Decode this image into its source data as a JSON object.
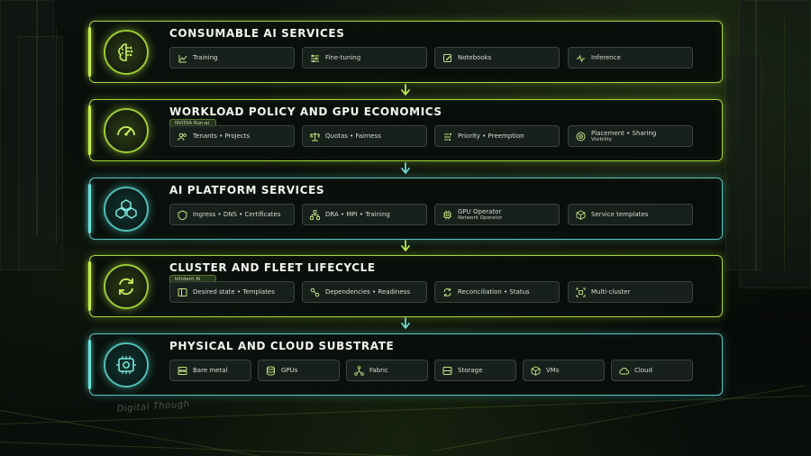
{
  "colors": {
    "green": "#a6d83a",
    "teal": "#56c8c2",
    "background": "#070a09"
  },
  "watermark": "Digital Though",
  "layers": [
    {
      "title": "CONSUMABLE AI SERVICES",
      "badge": "",
      "accent": "green",
      "emblem_icon": "brain-icon",
      "chips": [
        {
          "icon": "chart-line-icon",
          "label": "Training",
          "sub": ""
        },
        {
          "icon": "sliders-icon",
          "label": "Fine-tuning",
          "sub": ""
        },
        {
          "icon": "notebook-edit-icon",
          "label": "Notebooks",
          "sub": ""
        },
        {
          "icon": "pulse-icon",
          "label": "Inference",
          "sub": ""
        }
      ]
    },
    {
      "title": "WORKLOAD POLICY AND GPU ECONOMICS",
      "badge": "NVIDIA Run:ai",
      "accent": "green",
      "emblem_icon": "gauge-icon",
      "chips": [
        {
          "icon": "users-icon",
          "label": "Tenants • Projects",
          "sub": ""
        },
        {
          "icon": "scale-icon",
          "label": "Quotas • Fairness",
          "sub": ""
        },
        {
          "icon": "priority-icon",
          "label": "Priority • Preemption",
          "sub": ""
        },
        {
          "icon": "target-icon",
          "label": "Placement • Sharing",
          "sub": "Visibility"
        }
      ]
    },
    {
      "title": "AI PLATFORM SERVICES",
      "badge": "",
      "accent": "teal",
      "emblem_icon": "cubes-icon",
      "chips": [
        {
          "icon": "shield-icon",
          "label": "Ingress • DNS • Certificates",
          "sub": ""
        },
        {
          "icon": "network-icon",
          "label": "DRA • MPI • Training",
          "sub": ""
        },
        {
          "icon": "chip-icon",
          "label": "GPU Operator",
          "sub": "Network Operator"
        },
        {
          "icon": "box-icon",
          "label": "Service templates",
          "sub": ""
        }
      ]
    },
    {
      "title": "CLUSTER AND FLEET LIFECYCLE",
      "badge": "k0rdent AI",
      "accent": "green",
      "emblem_icon": "sync-icon",
      "chips": [
        {
          "icon": "template-icon",
          "label": "Desired state • Templates",
          "sub": ""
        },
        {
          "icon": "dependencies-icon",
          "label": "Dependencies • Readiness",
          "sub": ""
        },
        {
          "icon": "refresh-icon",
          "label": "Reconciliation • Status",
          "sub": ""
        },
        {
          "icon": "multi-cluster-icon",
          "label": "Multi-cluster",
          "sub": ""
        }
      ]
    },
    {
      "title": "PHYSICAL AND CLOUD SUBSTRATE",
      "badge": "",
      "accent": "teal",
      "emblem_icon": "server-chip-icon",
      "chips": [
        {
          "icon": "server-icon",
          "label": "Bare metal",
          "sub": ""
        },
        {
          "icon": "database-icon",
          "label": "GPUs",
          "sub": ""
        },
        {
          "icon": "fabric-icon",
          "label": "Fabric",
          "sub": ""
        },
        {
          "icon": "storage-icon",
          "label": "Storage",
          "sub": ""
        },
        {
          "icon": "vm-icon",
          "label": "VMs",
          "sub": ""
        },
        {
          "icon": "cloud-icon",
          "label": "Cloud",
          "sub": ""
        }
      ]
    }
  ]
}
